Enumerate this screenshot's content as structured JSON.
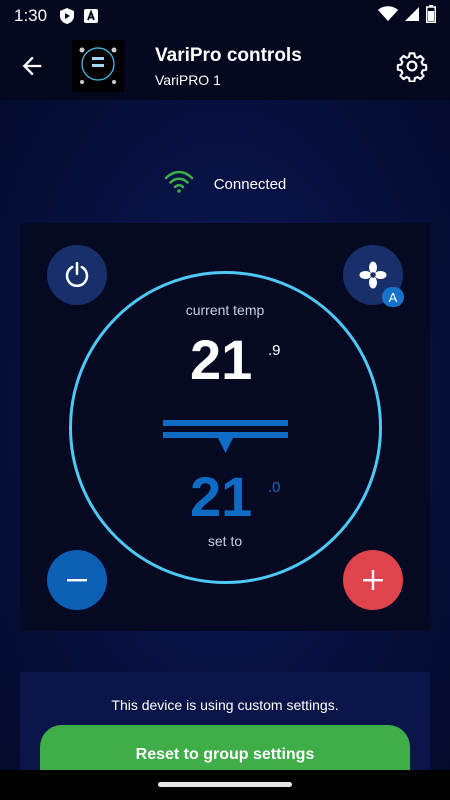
{
  "status_bar": {
    "time": "1:30",
    "icons": [
      "play-protect-icon",
      "a-notification-icon",
      "wifi-icon",
      "cell-signal-icon",
      "battery-icon"
    ]
  },
  "app_bar": {
    "title": "VariPro controls",
    "subtitle": "VariPRO 1",
    "back_icon": "arrow-back-icon",
    "settings_icon": "gear-icon"
  },
  "connection": {
    "status": "Connected",
    "icon": "wifi-icon",
    "color": "#3fae49"
  },
  "thermostat": {
    "current_label": "current temp",
    "current_value": "21",
    "current_decimal": ".9",
    "set_value": "21",
    "set_decimal": ".0",
    "set_label": "set to",
    "fan_mode_badge": "A",
    "ring_color": "#4ec8f5",
    "setpoint_color": "#0f6cc4"
  },
  "custom_settings": {
    "message": "This device is using custom settings.",
    "reset_label": "Reset to group settings",
    "button_color": "#3fae49"
  }
}
